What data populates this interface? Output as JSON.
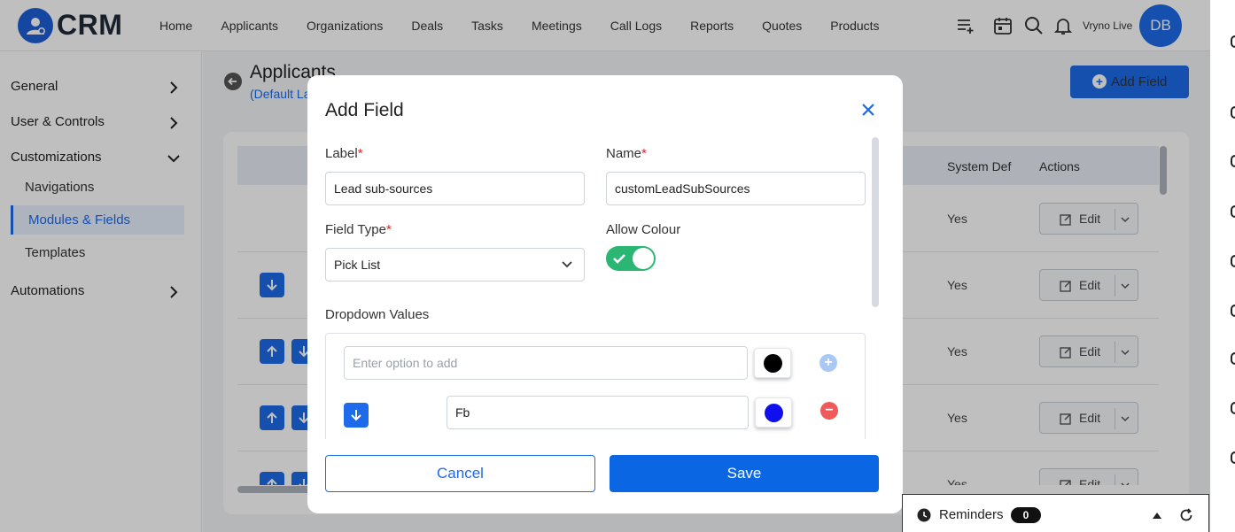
{
  "app": {
    "logo_text": "CRM",
    "org_name": "Vryno Live",
    "avatar_initials": "DB"
  },
  "nav": [
    {
      "label": "Home"
    },
    {
      "label": "Applicants"
    },
    {
      "label": "Organizations"
    },
    {
      "label": "Deals"
    },
    {
      "label": "Tasks"
    },
    {
      "label": "Meetings"
    },
    {
      "label": "Call Logs"
    },
    {
      "label": "Reports"
    },
    {
      "label": "Quotes"
    },
    {
      "label": "Products"
    }
  ],
  "top_icons": [
    "list-add-icon",
    "calendar-icon",
    "search-icon",
    "bell-icon"
  ],
  "sidebar": {
    "general": "General",
    "user_controls": "User & Controls",
    "customizations": "Customizations",
    "navigations": "Navigations",
    "modules_fields": "Modules & Fields",
    "templates": "Templates",
    "automations": "Automations"
  },
  "page": {
    "title": "Applicants",
    "subtitle": "(Default Layout)",
    "add_field_label": "Add Field"
  },
  "table": {
    "headers": {
      "system_def": "System Def",
      "actions": "Actions"
    },
    "rows": [
      {
        "system_def": "Yes",
        "edit": "Edit"
      },
      {
        "system_def": "Yes",
        "edit": "Edit"
      },
      {
        "system_def": "Yes",
        "edit": "Edit"
      },
      {
        "system_def": "Yes",
        "edit": "Edit"
      },
      {
        "system_def": "Yes",
        "edit": "Edit"
      }
    ]
  },
  "modal": {
    "title": "Add Field",
    "label_label": "Label",
    "label_value": "Lead sub-sources",
    "name_label": "Name",
    "name_value": "customLeadSubSources",
    "field_type_label": "Field Type",
    "field_type_value": "Pick List",
    "allow_colour_label": "Allow Colour",
    "allow_colour_on": true,
    "dropdown_label": "Dropdown Values",
    "new_option_placeholder": "Enter option to add",
    "new_option_color": "#000000",
    "options": [
      {
        "value": "Fb",
        "color": "#1010ee"
      }
    ],
    "cancel_label": "Cancel",
    "save_label": "Save"
  },
  "reminders": {
    "label": "Reminders",
    "count": "0"
  },
  "colors": {
    "primary": "#1d6bea",
    "toggle_on": "#2bb673",
    "add_circle": "#a9c8f5",
    "remove_circle": "#ef5b5b"
  }
}
